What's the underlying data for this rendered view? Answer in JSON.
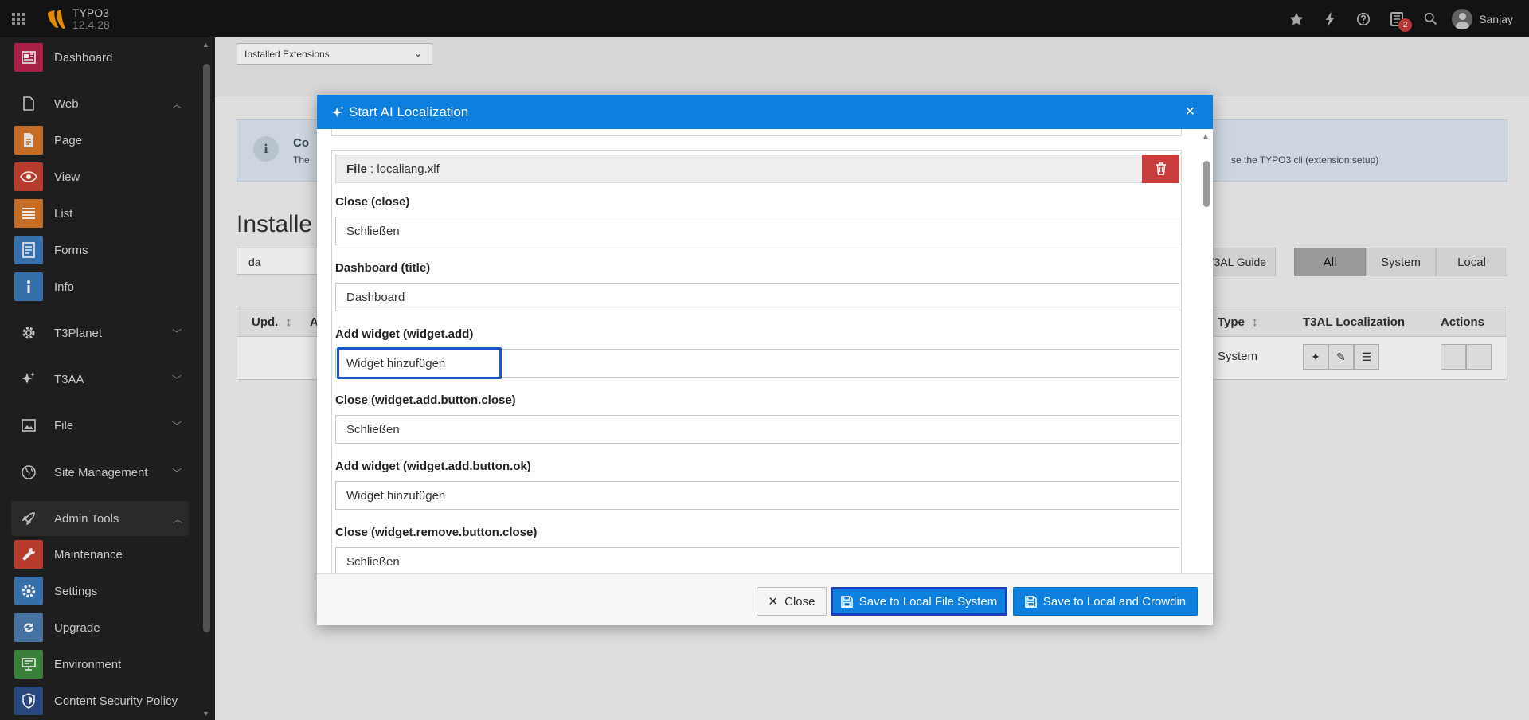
{
  "app": {
    "name": "TYPO3",
    "version": "12.4.28",
    "user": "Sanjay",
    "notification_count": "2"
  },
  "sidebar": {
    "items": [
      {
        "label": "Dashboard",
        "icon": "dashboard-icon",
        "color": "#b9224d"
      },
      {
        "label": "Web",
        "icon": "web-icon",
        "group": true,
        "expanded": true
      },
      {
        "label": "Page",
        "icon": "page-icon",
        "color": "#d4772a"
      },
      {
        "label": "View",
        "icon": "view-icon",
        "color": "#c84232"
      },
      {
        "label": "List",
        "icon": "list-icon",
        "color": "#d4772a"
      },
      {
        "label": "Forms",
        "icon": "forms-icon",
        "color": "#3b79b9"
      },
      {
        "label": "Info",
        "icon": "info-icon",
        "color": "#3b79b9"
      },
      {
        "label": "T3Planet",
        "icon": "gear-icon",
        "group": true,
        "expanded": false
      },
      {
        "label": "T3AA",
        "icon": "sparkle-icon",
        "group": true,
        "expanded": false
      },
      {
        "label": "File",
        "icon": "image-icon",
        "group": true,
        "expanded": false
      },
      {
        "label": "Site Management",
        "icon": "globe-icon",
        "group": true,
        "expanded": false
      },
      {
        "label": "Admin Tools",
        "icon": "rocket-icon",
        "group": true,
        "expanded": true
      },
      {
        "label": "Maintenance",
        "icon": "wrench-icon",
        "color": "#c84232"
      },
      {
        "label": "Settings",
        "icon": "settings-icon",
        "color": "#3b79b9"
      },
      {
        "label": "Upgrade",
        "icon": "upgrade-icon",
        "color": "#4d7cae"
      },
      {
        "label": "Environment",
        "icon": "environment-icon",
        "color": "#3f8a3f"
      },
      {
        "label": "Content Security Policy",
        "icon": "shield-icon",
        "color": "#2c4f88"
      }
    ]
  },
  "content": {
    "select_value": "Installed Extensions",
    "callout": {
      "title": "Co",
      "text_left": "The",
      "text_right": "se the TYPO3 cli (extension:setup)"
    },
    "heading": "Installe",
    "filter_value": "da",
    "guide_button": "T3AL Guide",
    "filter_tabs": [
      "All",
      "System",
      "Local"
    ],
    "active_tab": "All",
    "table": {
      "headers": {
        "upd": "Upd.",
        "a": "A",
        "type": "Type",
        "loc": "T3AL Localization",
        "actions": "Actions"
      },
      "row": {
        "type": "System"
      }
    }
  },
  "modal": {
    "title": "Start AI Localization",
    "file_label": "File",
    "file_name": "localiang.xlf",
    "fields": [
      {
        "label": "Close (close)",
        "value": "Schließen"
      },
      {
        "label": "Dashboard (title)",
        "value": "Dashboard"
      },
      {
        "label": "Add widget (widget.add)",
        "value": "Widget hinzufügen",
        "focused": true
      },
      {
        "label": "Close (widget.add.button.close)",
        "value": "Schließen"
      },
      {
        "label": "Add widget (widget.add.button.ok)",
        "value": "Widget hinzufügen"
      },
      {
        "label": "Close (widget.remove.button.close)",
        "value": "Schließen"
      }
    ],
    "buttons": {
      "close": "Close",
      "save_local": "Save to Local File System",
      "save_crowdin": "Save to Local and Crowdin"
    }
  },
  "colors": {
    "accent": "#0d7fde",
    "danger": "#c83c3c",
    "topbar": "#151515",
    "sidebar": "#212121"
  }
}
